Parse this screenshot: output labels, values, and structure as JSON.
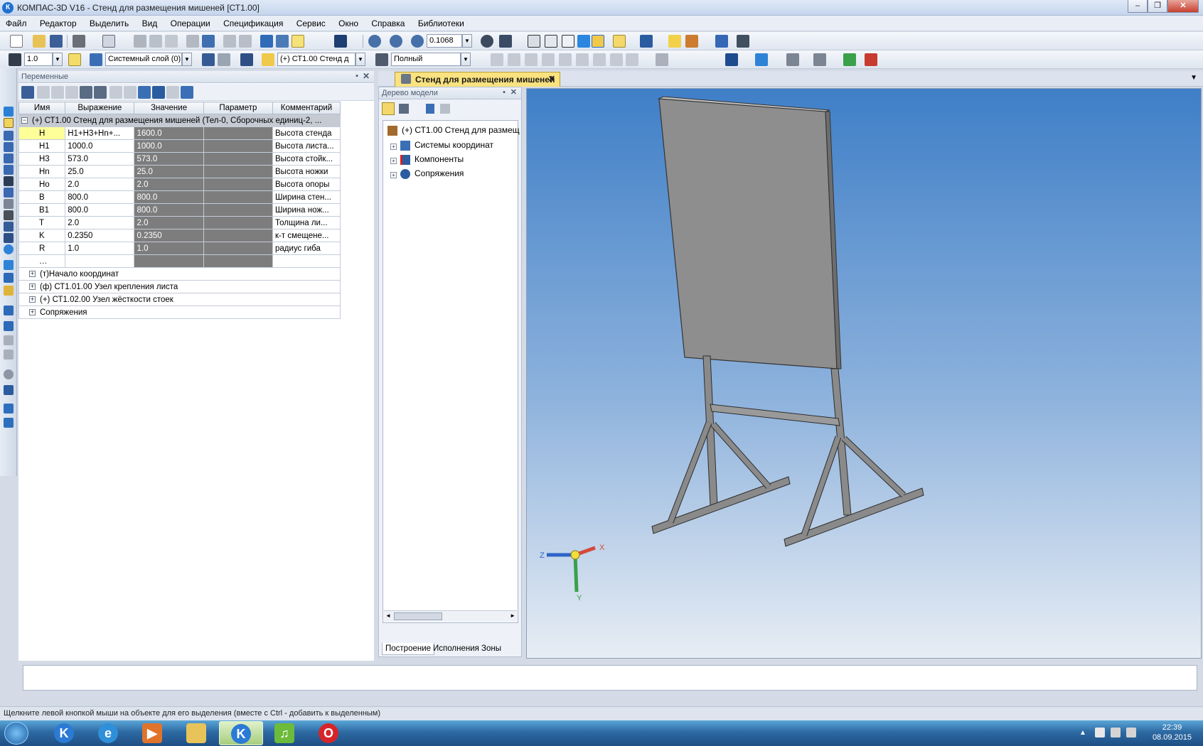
{
  "window": {
    "title": "КОМПАС-3D V16  - Стенд для размещения мишеней [СТ1.00]",
    "app_icon_letter": "К",
    "buttons": {
      "minimize": "–",
      "maximize": "❐",
      "close": "✕"
    }
  },
  "menu": [
    "Файл",
    "Редактор",
    "Выделить",
    "Вид",
    "Операции",
    "Спецификация",
    "Сервис",
    "Окно",
    "Справка",
    "Библиотеки"
  ],
  "toolbar1": {
    "zoom_value": "0.1068"
  },
  "toolbar2": {
    "step_value": "1.0",
    "layer": "Системный слой (0)",
    "part": "(+) СТ1.00 Стенд д",
    "view_mode": "Полный"
  },
  "variables_panel": {
    "title": "Переменные",
    "columns": [
      "Имя",
      "Выражение",
      "Значение",
      "Параметр",
      "Комментарий"
    ],
    "group": "(+) СТ1.00 Стенд для размещения мишеней (Тел-0, Сборочных единиц-2, ...",
    "rows": [
      {
        "name": "H",
        "expr": "H1+H3+Hn+...",
        "value": "1600.0",
        "comment": "Высота стенда"
      },
      {
        "name": "H1",
        "expr": "1000.0",
        "value": "1000.0",
        "comment": "Высота листа..."
      },
      {
        "name": "H3",
        "expr": "573.0",
        "value": "573.0",
        "comment": "Высота стойк..."
      },
      {
        "name": "Hn",
        "expr": "25.0",
        "value": "25.0",
        "comment": "Высота ножки"
      },
      {
        "name": "Ho",
        "expr": "2.0",
        "value": "2.0",
        "comment": "Высота опоры"
      },
      {
        "name": "B",
        "expr": "800.0",
        "value": "800.0",
        "comment": "Ширина стен..."
      },
      {
        "name": "B1",
        "expr": "800.0",
        "value": "800.0",
        "comment": "Ширина нож..."
      },
      {
        "name": "T",
        "expr": "2.0",
        "value": "2.0",
        "comment": "Толщина ли..."
      },
      {
        "name": "K",
        "expr": "0.2350",
        "value": "0.2350",
        "comment": "к-т смещене..."
      },
      {
        "name": "R",
        "expr": "1.0",
        "value": "1.0",
        "comment": "радиус гиба"
      }
    ],
    "subgroups": [
      "(т)Начало координат",
      "(ф) СТ1.01.00 Узел крепления листа",
      "(+) СТ1.02.00 Узел жёсткости стоек",
      "Сопряжения"
    ]
  },
  "document_tab": "Стенд для размещения мишеней",
  "model_tree": {
    "title": "Дерево модели",
    "root": "(+) СТ1.00 Стенд для размещ",
    "items": [
      "Системы координат",
      "Компоненты",
      "Сопряжения"
    ],
    "bottom_tabs": [
      "Построение",
      "Исполнения",
      "Зоны"
    ]
  },
  "axes": {
    "x": "X",
    "y": "Y",
    "z": "Z"
  },
  "status_text": "Щелкните левой кнопкой мыши на объекте для его выделения (вместе с Ctrl - добавить к выделенным)",
  "clock": {
    "time": "22:39",
    "date": "08.09.2015"
  },
  "colors": {
    "accent_tab": "#f9e27f",
    "viewport_top": "#3f7fc7",
    "value_cell": "#7d7d7d"
  }
}
